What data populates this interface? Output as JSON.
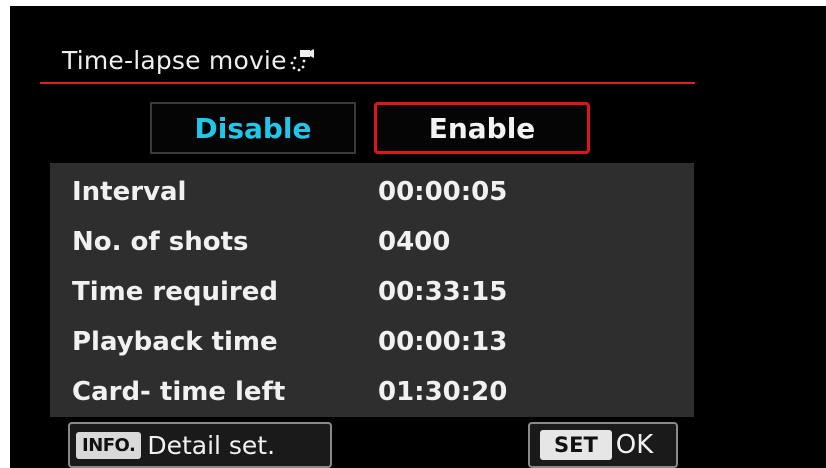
{
  "header": {
    "title": "Time-lapse movie",
    "title_icon": "time-lapse-movie-icon"
  },
  "options": {
    "disable_label": "Disable",
    "enable_label": "Enable",
    "selected": "Enable"
  },
  "settings": [
    {
      "label": "Interval",
      "value": "00:00:05"
    },
    {
      "label": "No. of shots",
      "value": "0400"
    },
    {
      "label": "Time required",
      "value": "00:33:15"
    },
    {
      "label": "Playback time",
      "value": "00:00:13"
    },
    {
      "label": "Card- time left",
      "value": "01:30:20"
    }
  ],
  "footer": {
    "info_badge": "INFO.",
    "info_text": "Detail set.",
    "set_badge": "SET",
    "set_text": "OK"
  },
  "colors": {
    "accent_red": "#d8231e",
    "disable_cyan": "#1fc8e8",
    "panel_gray": "#2e2e2e"
  }
}
